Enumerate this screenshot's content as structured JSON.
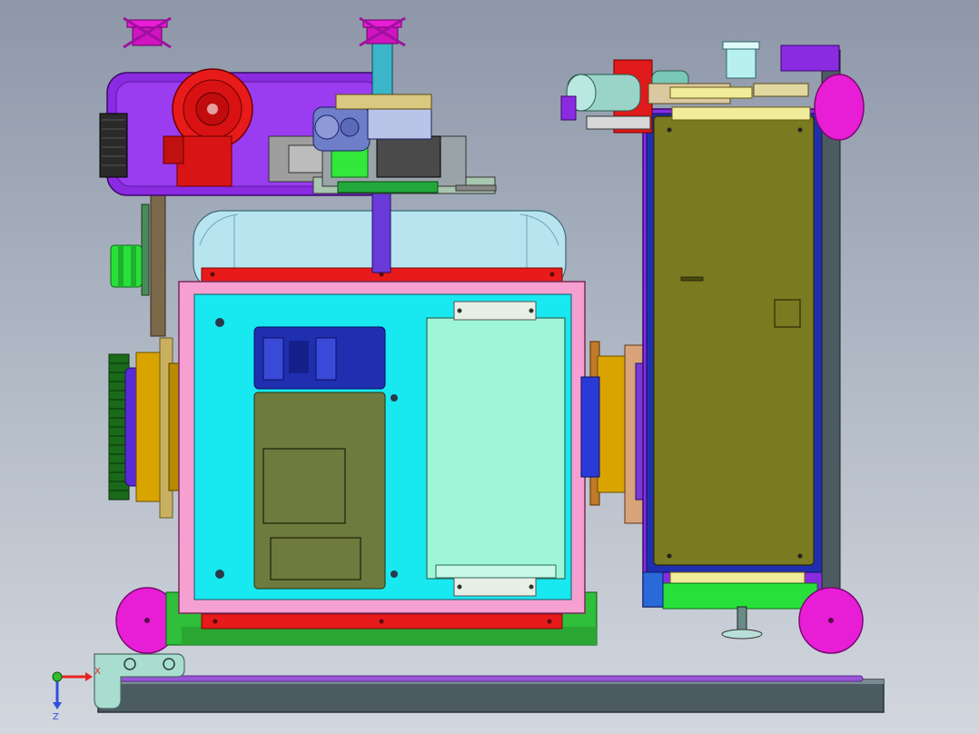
{
  "viewport": {
    "kind": "3D CAD orthographic front view of a machine assembly",
    "background_top": "#8d97a8",
    "background_bottom": "#d2d7de"
  },
  "triad": {
    "x_label": "X",
    "z_label": "Z",
    "x_color": "#e8231f",
    "y_color": "#2fbf2f",
    "z_color": "#2f4fd8"
  },
  "colors": {
    "magenta": "#e21ed0",
    "purple": "#8a2be2",
    "red": "#e01a1a",
    "cyan": "#18e8f0",
    "pink": "#f6a0d2",
    "olive": "#6f7a3e",
    "mint": "#9ff5d8",
    "navy": "#1f2fb0",
    "gold": "#d9a400",
    "lime": "#2ee83a",
    "green": "#26c93c",
    "slate": "#4c5a62",
    "lightblue": "#b8e4ef"
  }
}
